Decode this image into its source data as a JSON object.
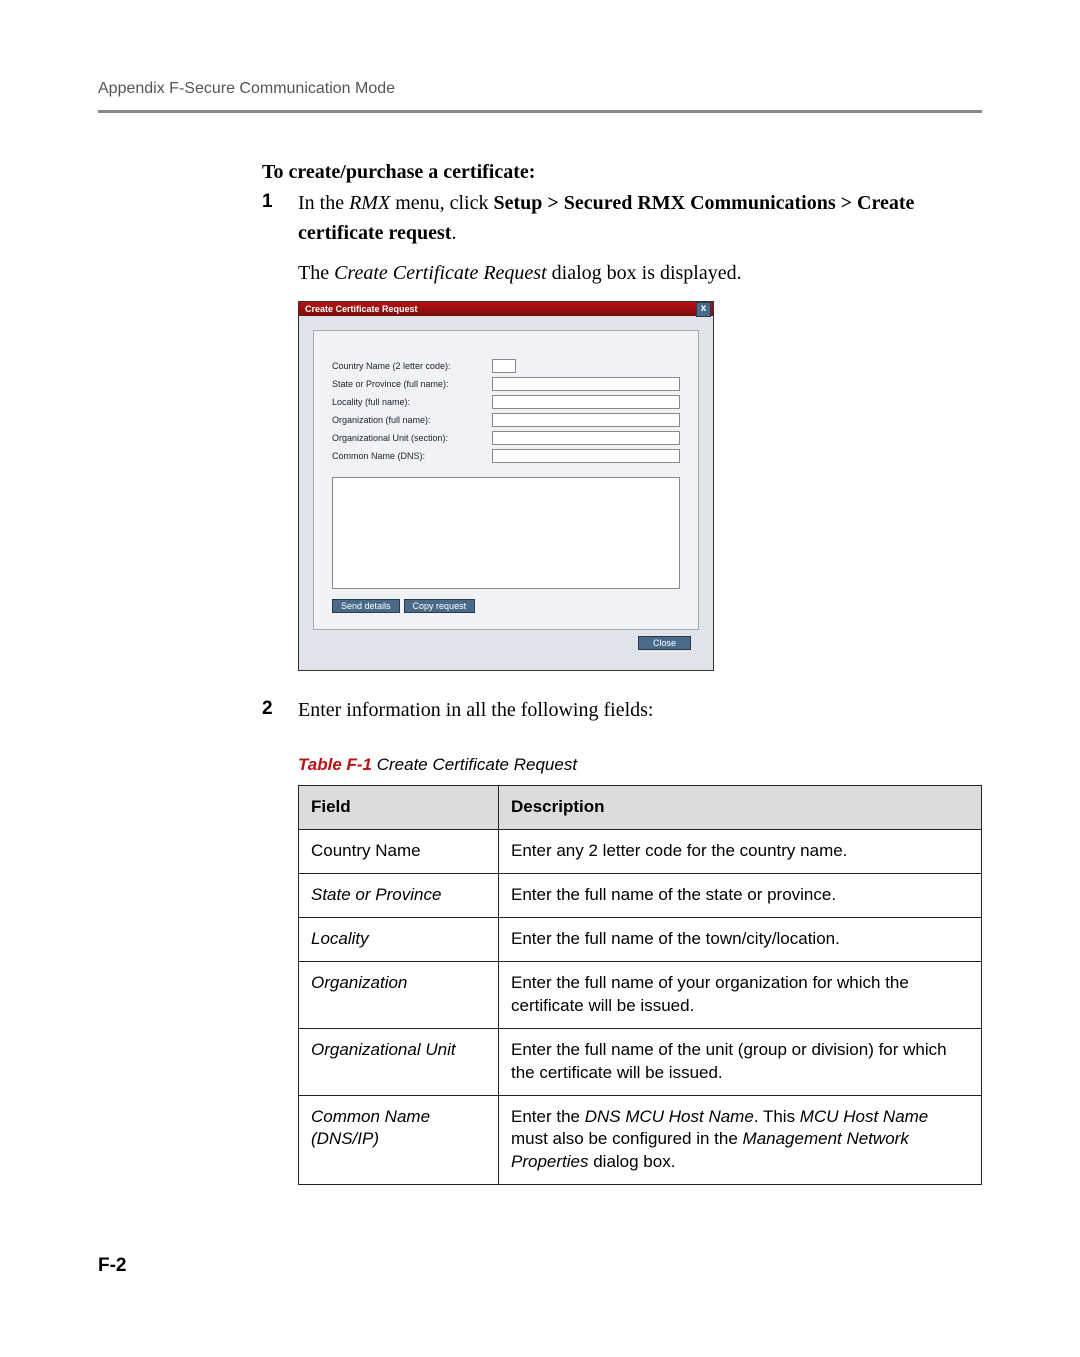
{
  "header": {
    "running": "Appendix F-Secure Communication Mode"
  },
  "content": {
    "heading": "To create/purchase a certificate:",
    "step1_num": "1",
    "step1_pre": "In the ",
    "step1_rmx": "RMX",
    "step1_mid": " menu, click ",
    "step1_bold": "Setup > Secured RMX Communications > Create certificate request",
    "step1_post": ".",
    "step1_follow_pre": "The ",
    "step1_follow_it": "Create Certificate Request",
    "step1_follow_post": " dialog box is displayed.",
    "step2_num": "2",
    "step2_text": "Enter information in all the following fields:"
  },
  "dialog": {
    "title": "Create Certificate Request",
    "close": "x",
    "labels": {
      "l1": "Country Name (2 letter code):",
      "l2": "State or Province (full name):",
      "l3": "Locality (full name):",
      "l4": "Organization (full name):",
      "l5": "Organizational Unit (section):",
      "l6": "Common Name (DNS):"
    },
    "btn_send": "Send details",
    "btn_copy": "Copy request",
    "btn_close": "Close"
  },
  "table": {
    "captionNum": "Table F-1",
    "captionText": " Create Certificate Request",
    "head_field": "Field",
    "head_desc": "Description",
    "rows": [
      {
        "f": "Country Name",
        "italic": false,
        "d": "Enter any 2 letter code for the country name."
      },
      {
        "f": "State or Province",
        "italic": true,
        "d": "Enter the full name of the state or province."
      },
      {
        "f": "Locality",
        "italic": true,
        "d": "Enter the full name of the town/city/location."
      },
      {
        "f": "Organization",
        "italic": true,
        "d": "Enter the full name of your organization for which the certificate will be issued."
      },
      {
        "f": "Organizational Unit",
        "italic": true,
        "d": "Enter the full name of the unit (group or division) for which the certificate will be issued."
      }
    ],
    "row6": {
      "f": "Common Name (DNS/IP)",
      "d_pre": "Enter the ",
      "d_it1": "DNS MCU Host Name",
      "d_mid1": ". This ",
      "d_it2": "MCU Host Name",
      "d_mid2": " must also be configured in the ",
      "d_it3": "Management Network Properties",
      "d_post": " dialog box."
    }
  },
  "pageNum": "F-2"
}
